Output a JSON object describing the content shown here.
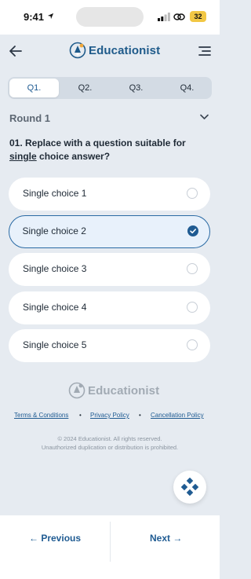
{
  "status_bar": {
    "time": "9:41",
    "battery": "32"
  },
  "header": {
    "brand": "Educationist"
  },
  "tabs": [
    {
      "label": "Q1.",
      "active": true
    },
    {
      "label": "Q2.",
      "active": false
    },
    {
      "label": "Q3.",
      "active": false
    },
    {
      "label": "Q4.",
      "active": false
    }
  ],
  "round": {
    "label": "Round 1"
  },
  "question": {
    "prefix": "01. Replace with a question suitable for ",
    "underlined": "single",
    "suffix": " choice answer?"
  },
  "choices": [
    {
      "label": "Single choice 1",
      "selected": false
    },
    {
      "label": "Single choice 2",
      "selected": true
    },
    {
      "label": "Single choice 3",
      "selected": false
    },
    {
      "label": "Single choice 4",
      "selected": false
    },
    {
      "label": "Single choice 5",
      "selected": false
    }
  ],
  "footer": {
    "brand": "Educationist",
    "links": [
      "Terms & Conditions",
      "Privacy Policy",
      "Cancellation Policy"
    ],
    "copyright_line1": "© 2024 Educationist. All rights reserved.",
    "copyright_line2": "Unauthorized duplication or distribution is prohibited."
  },
  "nav": {
    "previous": "← Previous",
    "next": "Next →"
  },
  "colors": {
    "accent": "#1f5b92",
    "background": "#e6ebf1"
  }
}
